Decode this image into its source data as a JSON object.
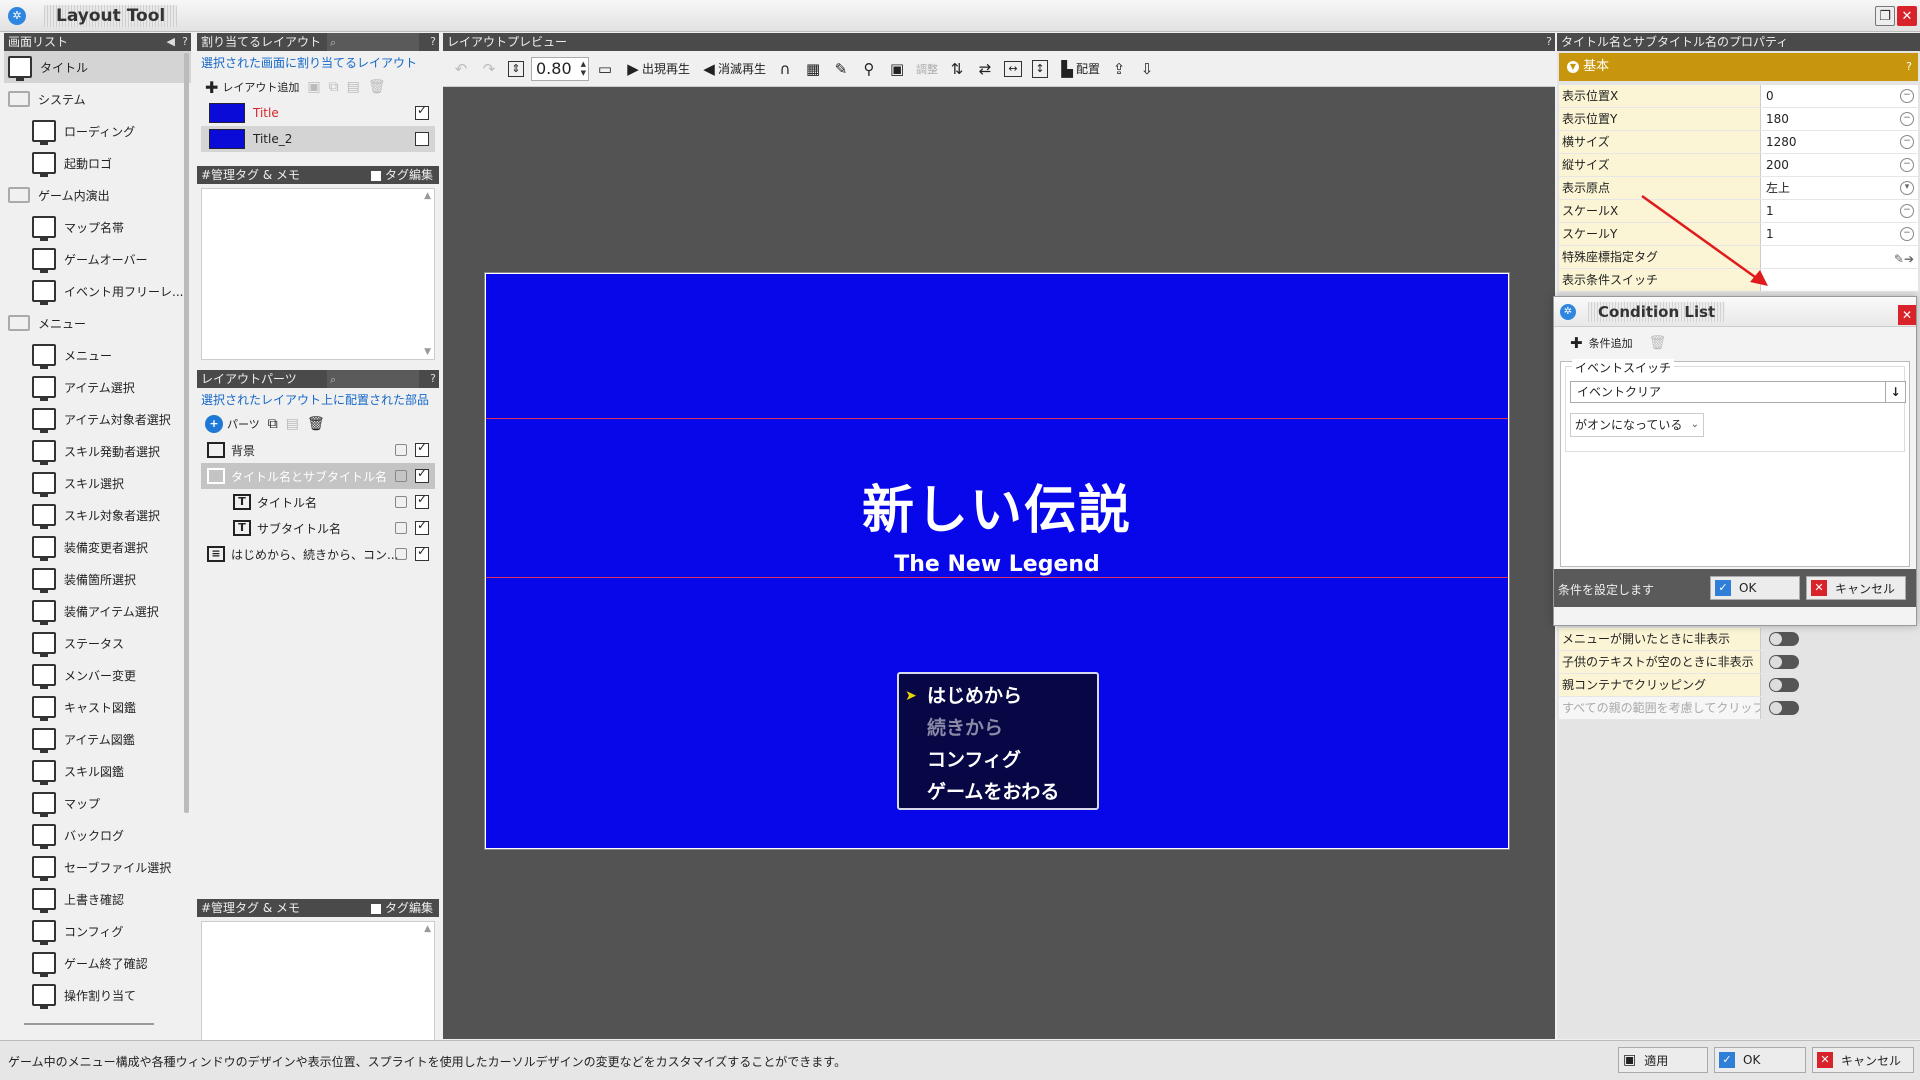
{
  "app": {
    "title": "Layout Tool"
  },
  "screen_list": {
    "header": "画面リスト",
    "items": [
      {
        "label": "タイトル",
        "type": "screen",
        "level": 0,
        "selected": true
      },
      {
        "label": "システム",
        "type": "folder",
        "level": 0
      },
      {
        "label": "ローディング",
        "type": "screen",
        "level": 1
      },
      {
        "label": "起動ロゴ",
        "type": "screen",
        "level": 1
      },
      {
        "label": "ゲーム内演出",
        "type": "folder",
        "level": 0
      },
      {
        "label": "マップ名帯",
        "type": "screen",
        "level": 1
      },
      {
        "label": "ゲームオーバー",
        "type": "screen",
        "level": 1
      },
      {
        "label": "イベント用フリーレ...",
        "type": "screen",
        "level": 1
      },
      {
        "label": "メニュー",
        "type": "folder",
        "level": 0
      },
      {
        "label": "メニュー",
        "type": "screen",
        "level": 1
      },
      {
        "label": "アイテム選択",
        "type": "screen",
        "level": 1
      },
      {
        "label": "アイテム対象者選択",
        "type": "screen",
        "level": 1
      },
      {
        "label": "スキル発動者選択",
        "type": "screen",
        "level": 1
      },
      {
        "label": "スキル選択",
        "type": "screen",
        "level": 1
      },
      {
        "label": "スキル対象者選択",
        "type": "screen",
        "level": 1
      },
      {
        "label": "装備変更者選択",
        "type": "screen",
        "level": 1
      },
      {
        "label": "装備箇所選択",
        "type": "screen",
        "level": 1
      },
      {
        "label": "装備アイテム選択",
        "type": "screen",
        "level": 1
      },
      {
        "label": "ステータス",
        "type": "screen",
        "level": 1
      },
      {
        "label": "メンバー変更",
        "type": "screen",
        "level": 1
      },
      {
        "label": "キャスト図鑑",
        "type": "screen",
        "level": 1
      },
      {
        "label": "アイテム図鑑",
        "type": "screen",
        "level": 1
      },
      {
        "label": "スキル図鑑",
        "type": "screen",
        "level": 1
      },
      {
        "label": "マップ",
        "type": "screen",
        "level": 1
      },
      {
        "label": "バックログ",
        "type": "screen",
        "level": 1
      },
      {
        "label": "セーブファイル選択",
        "type": "screen",
        "level": 1
      },
      {
        "label": "上書き確認",
        "type": "screen",
        "level": 1
      },
      {
        "label": "コンフィグ",
        "type": "screen",
        "level": 1
      },
      {
        "label": "ゲーム終了確認",
        "type": "screen",
        "level": 1
      },
      {
        "label": "操作割り当て",
        "type": "screen",
        "level": 1
      }
    ]
  },
  "layouts": {
    "header": "割り当てるレイアウト",
    "desc": "選択された画面に割り当てるレイアウト",
    "add_label": "レイアウト追加",
    "items": [
      {
        "name": "Title",
        "checked": true,
        "active": true
      },
      {
        "name": "Title_2",
        "checked": false,
        "active": false
      }
    ]
  },
  "tags_top": {
    "header": "#管理タグ & メモ",
    "edit_label": "タグ編集"
  },
  "parts": {
    "header": "レイアウトパーツ",
    "desc": "選択されたレイアウト上に配置された部品",
    "add_label": "パーツ",
    "items": [
      {
        "name": "背景",
        "kind": "folder",
        "indent": 0,
        "checked": true
      },
      {
        "name": "タイトル名とサブタイトル名",
        "kind": "folder",
        "indent": 0,
        "checked": true,
        "selected": true
      },
      {
        "name": "タイトル名",
        "kind": "text",
        "indent": 1,
        "checked": true
      },
      {
        "name": "サブタイトル名",
        "kind": "text",
        "indent": 1,
        "checked": true
      },
      {
        "name": "はじめから、続きから、コン...",
        "kind": "menu",
        "indent": 0,
        "checked": true
      }
    ]
  },
  "tags_bottom": {
    "header": "#管理タグ & メモ",
    "edit_label": "タグ編集"
  },
  "preview": {
    "header": "レイアウトプレビュー",
    "zoom": "0.80",
    "play_appear": "出現再生",
    "play_disappear": "消滅再生",
    "adjust_label": "調整",
    "arrange_label": "配置",
    "canvas": {
      "title": "新しい伝説",
      "subtitle": "The New Legend",
      "menu": [
        "はじめから",
        "続きから",
        "コンフィグ",
        "ゲームをおわる"
      ],
      "menu_disabled": [
        false,
        true,
        false,
        false
      ],
      "bg_color": "#0707ea"
    }
  },
  "properties": {
    "header": "タイトル名とサブタイトル名のプロパティ",
    "section": "基本",
    "rows": [
      {
        "key": "表示位置X",
        "value": "0"
      },
      {
        "key": "表示位置Y",
        "value": "180"
      },
      {
        "key": "横サイズ",
        "value": "1280"
      },
      {
        "key": "縦サイズ",
        "value": "200"
      },
      {
        "key": "表示原点",
        "value": "左上"
      },
      {
        "key": "スケールX",
        "value": "1"
      },
      {
        "key": "スケールY",
        "value": "1"
      },
      {
        "key": "特殊座標指定タグ",
        "value": ""
      },
      {
        "key": "表示条件スイッチ",
        "value": ""
      }
    ],
    "toggles": [
      {
        "key": "メニューが開いたときに非表示"
      },
      {
        "key": "子供のテキストが空のときに非表示"
      },
      {
        "key": "親コンテナでクリッピング"
      },
      {
        "key": "すべての親の範囲を考慮してクリップ"
      }
    ]
  },
  "dialog": {
    "title": "Condition List",
    "add_label": "条件追加",
    "group_label": "イベントスイッチ",
    "switch_value": "イベントクリア",
    "state_value": "がオンになっている",
    "hint": "条件を設定します",
    "ok": "OK",
    "cancel": "キャンセル"
  },
  "statusbar": {
    "message": "ゲーム中のメニュー構成や各種ウィンドウのデザインや表示位置、スプライトを使用したカーソルデザインの変更などをカスタマイズすることができます。",
    "apply": "適用",
    "ok": "OK",
    "cancel": "キャンセル"
  },
  "colors": {
    "accent_header": "#c8960c",
    "link_blue": "#1468c9",
    "close_red": "#d8232a"
  }
}
